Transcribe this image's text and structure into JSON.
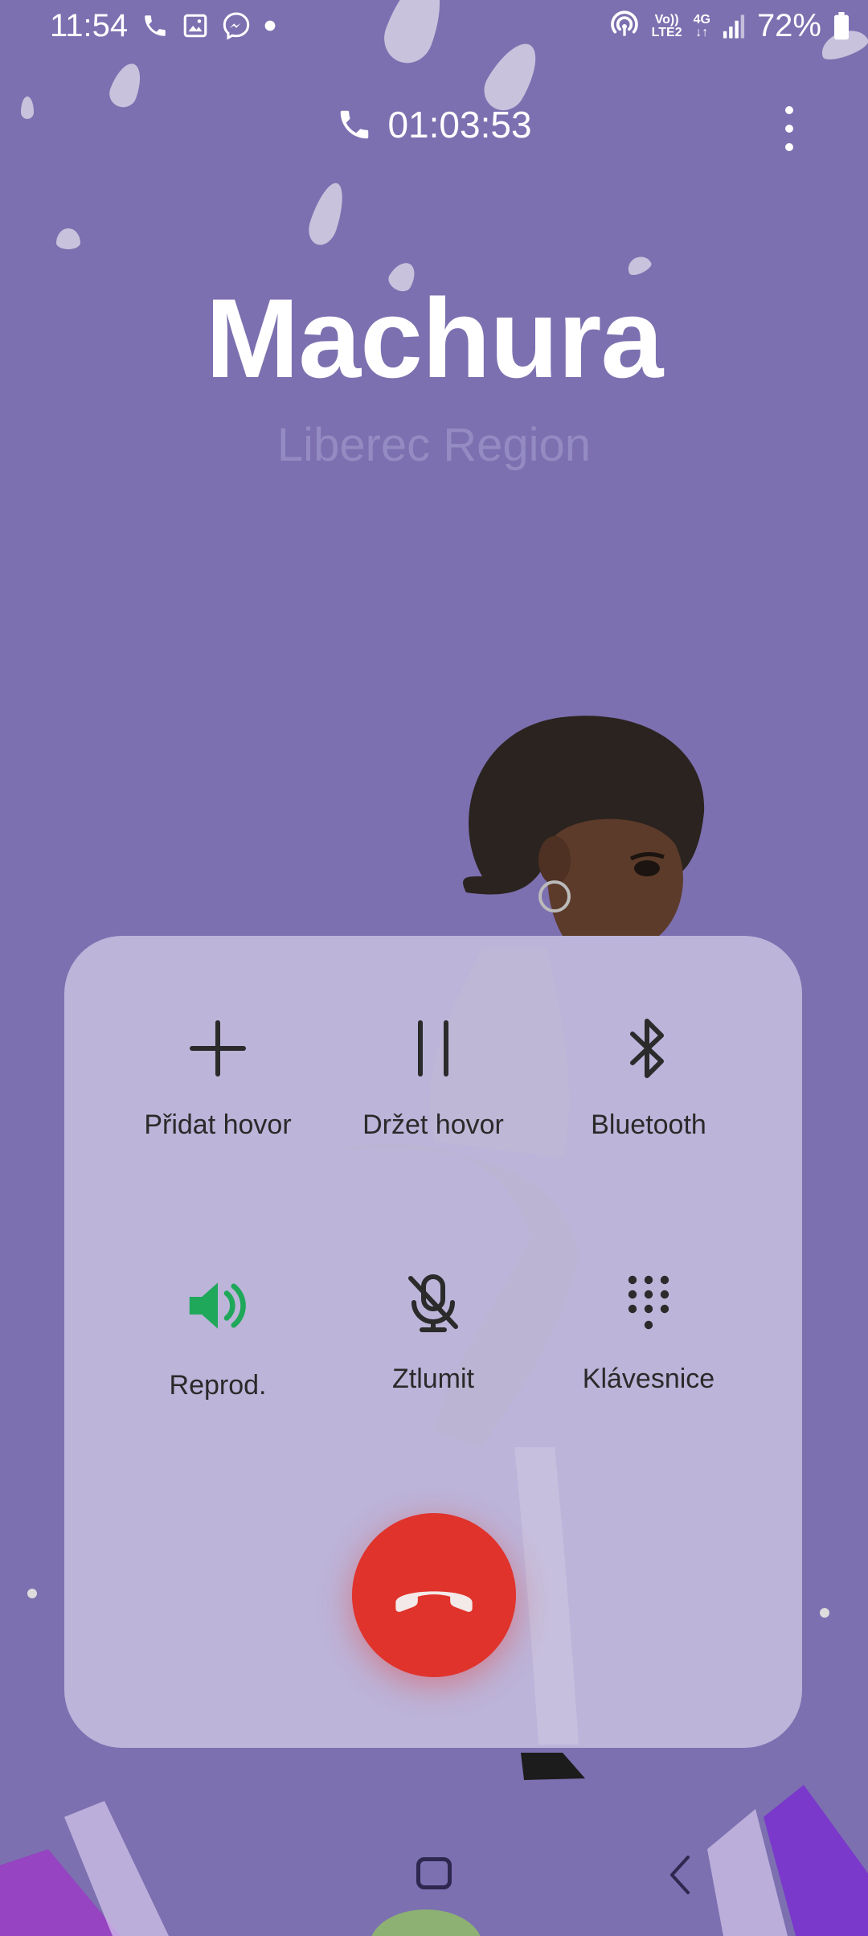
{
  "status_bar": {
    "time": "11:54",
    "left_icons": [
      "phone-icon",
      "gallery-icon",
      "messenger-icon",
      "dot-icon"
    ],
    "network_top": "Vo))",
    "network_bottom": "LTE2",
    "network_type": "4G",
    "battery": "72%"
  },
  "call": {
    "timer": "01:03:53",
    "contact_name": "Machura",
    "location": "Liberec Region"
  },
  "controls": {
    "add_call": "Přidat hovor",
    "hold_call": "Držet hovor",
    "bluetooth": "Bluetooth",
    "speaker": "Reprod.",
    "mute": "Ztlumit",
    "keypad": "Klávesnice"
  },
  "colors": {
    "background": "#7c70b0",
    "speaker_active": "#1fa85a",
    "end_call": "#e0332b"
  }
}
